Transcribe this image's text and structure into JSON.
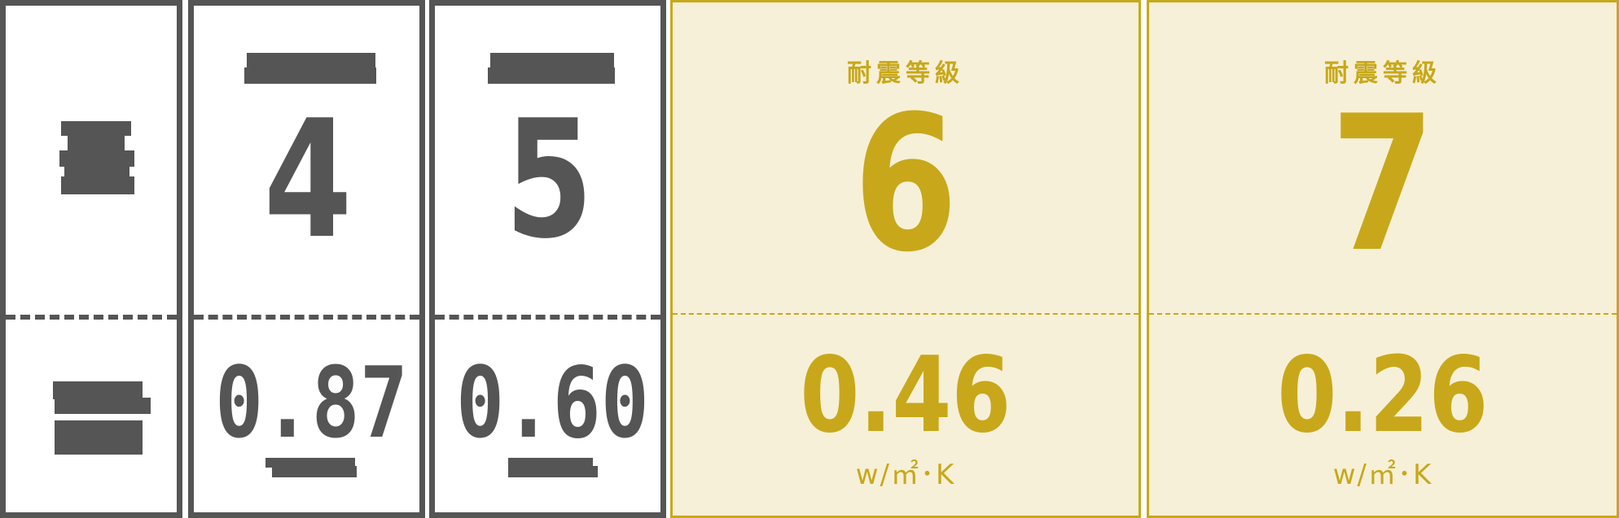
{
  "columns": [
    {
      "id": "header",
      "style": "gray",
      "top_label": "",
      "grade": "",
      "value": "",
      "unit": ""
    },
    {
      "id": "grade-4",
      "style": "gray",
      "top_label": "",
      "grade": "4",
      "value": "0.87",
      "unit": ""
    },
    {
      "id": "grade-5",
      "style": "gray",
      "top_label": "",
      "grade": "5",
      "value": "0.60",
      "unit": ""
    },
    {
      "id": "grade-6",
      "style": "gold",
      "top_label": "耐震等級",
      "grade": "6",
      "value": "0.46",
      "unit": "w/㎡･K"
    },
    {
      "id": "grade-7",
      "style": "gold",
      "top_label": "耐震等級",
      "grade": "7",
      "value": "0.26",
      "unit": "w/㎡･K"
    }
  ],
  "colors": {
    "gray": "#555555",
    "gold": "#c8a81a",
    "gold_bg": "#f7f0d8",
    "white": "#ffffff"
  }
}
